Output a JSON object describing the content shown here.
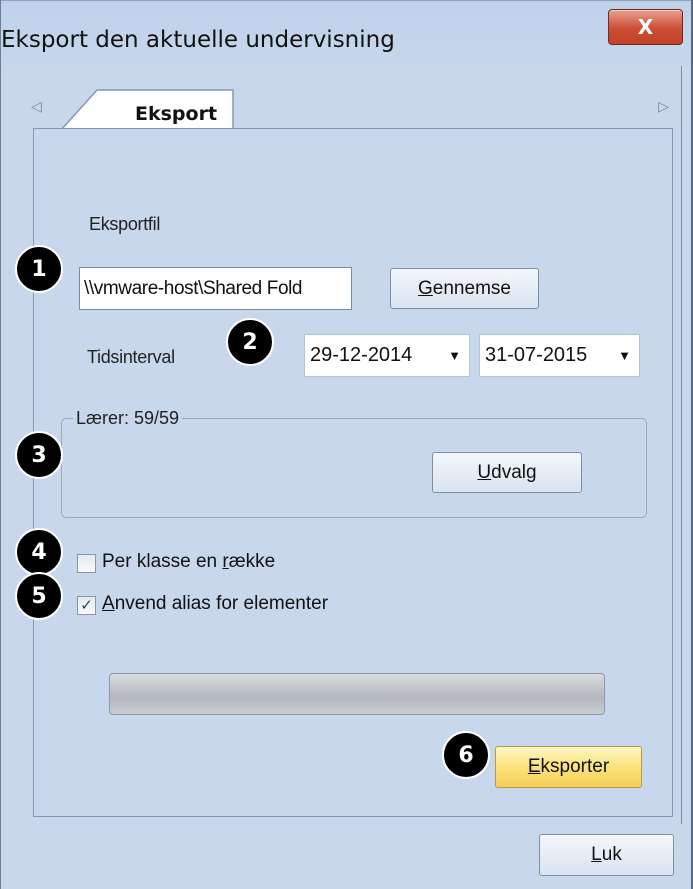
{
  "window": {
    "title": "Eksport den aktuelle undervisning",
    "close_glyph": "X"
  },
  "tabs": {
    "active_label": "Eksport",
    "scroll_left_glyph": "◁",
    "scroll_right_glyph": "▷"
  },
  "form": {
    "export_file_label": "Eksportfil",
    "export_file_value": "\\\\vmware-host\\Shared Fold",
    "browse_button_pre": "",
    "browse_button_key": "G",
    "browse_button_post": "ennemse",
    "time_interval_label": "Tidsinterval",
    "date_from": "29-12-2014",
    "date_to": "31-07-2015",
    "dropdown_glyph": "▼",
    "teacher_group_label": "Lærer: 59/59",
    "selection_button_key": "U",
    "selection_button_post": "dvalg",
    "per_class_pre": "Per klasse en ",
    "per_class_key": "r",
    "per_class_post": "ække",
    "per_class_checked": false,
    "use_alias_key": "A",
    "use_alias_post": "nvend alias for elementer",
    "use_alias_checked": true,
    "check_glyph": "✓",
    "progress_fraction": 0,
    "export_button_key": "E",
    "export_button_post": "ksporter"
  },
  "footer": {
    "close_button_key": "L",
    "close_button_post": "uk"
  },
  "callouts": [
    "1",
    "2",
    "3",
    "4",
    "5",
    "6"
  ]
}
